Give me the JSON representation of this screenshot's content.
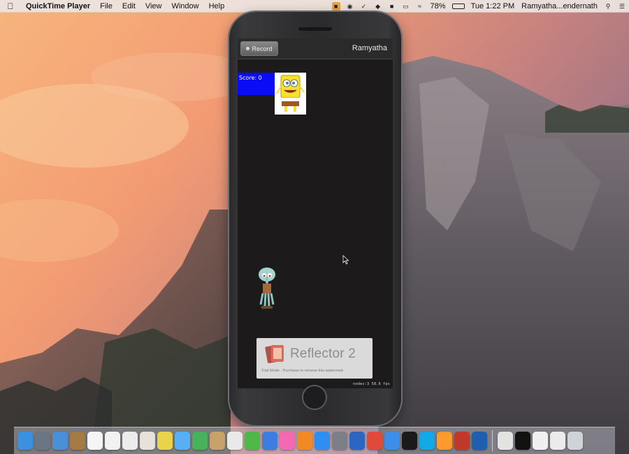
{
  "menubar": {
    "apple_icon": "apple-icon",
    "app_name": "QuickTime Player",
    "menus": [
      "File",
      "Edit",
      "View",
      "Window",
      "Help"
    ],
    "status_icons": [
      "app-status-icon",
      "record-status-icon",
      "check-status-icon",
      "dropbox-icon",
      "notification-icon",
      "airplay-icon",
      "wifi-icon"
    ],
    "battery": "78%",
    "battery_icon": "battery-icon",
    "clock": "Tue 1:22 PM",
    "user": "Ramyatha...endernath",
    "search_icon": "spotlight-search-icon",
    "list_icon": "notification-center-icon"
  },
  "phone": {
    "record_label": "Record",
    "user_label": "Ramyatha",
    "score_text": "Score: 0",
    "watermark_title": "Reflector 2",
    "watermark_sub": "Trial Mode · Purchase to remove this watermark",
    "fps_text": "nodes:3   58.6 fps"
  },
  "dock": {
    "icons": [
      {
        "name": "finder-icon",
        "color": "#3d8fe0"
      },
      {
        "name": "launchpad-icon",
        "color": "#6b7684"
      },
      {
        "name": "preview-icon",
        "color": "#4a8fd8"
      },
      {
        "name": "notes-book-icon",
        "color": "#a57b43"
      },
      {
        "name": "calendar-icon",
        "color": "#f5f5f5"
      },
      {
        "name": "textedit-icon",
        "color": "#f2f2f2"
      },
      {
        "name": "pages-icon",
        "color": "#ececec"
      },
      {
        "name": "photos-icon",
        "color": "#e6e1d9"
      },
      {
        "name": "chrome-legacy-icon",
        "color": "#e8d34a"
      },
      {
        "name": "messages-icon",
        "color": "#58b0f4"
      },
      {
        "name": "facetime-icon",
        "color": "#46b35b"
      },
      {
        "name": "contacts-icon",
        "color": "#c7a36b"
      },
      {
        "name": "stickies-icon",
        "color": "#e9e9e9"
      },
      {
        "name": "numbers-icon",
        "color": "#4fb848"
      },
      {
        "name": "keynote-icon",
        "color": "#3d7de0"
      },
      {
        "name": "itunes-icon",
        "color": "#f36ab3"
      },
      {
        "name": "ibooks-icon",
        "color": "#f08a24"
      },
      {
        "name": "app-store-icon",
        "color": "#2f8ef0"
      },
      {
        "name": "system-preferences-icon",
        "color": "#7c7f85"
      },
      {
        "name": "word-icon",
        "color": "#2b66c4"
      },
      {
        "name": "chrome-icon",
        "color": "#e04a3b"
      },
      {
        "name": "xcode-icon",
        "color": "#3d8ee8"
      },
      {
        "name": "terminal-icon",
        "color": "#1a1a1a"
      },
      {
        "name": "skype-icon",
        "color": "#12a9e6"
      },
      {
        "name": "sublime-icon",
        "color": "#ff9a2e"
      },
      {
        "name": "reflector-icon",
        "color": "#c0392b"
      },
      {
        "name": "quicktime-icon",
        "color": "#1f5fb2"
      },
      {
        "name": "downloads-icon",
        "color": "#e3e3e3"
      },
      {
        "name": "terminal-window-icon",
        "color": "#111111"
      },
      {
        "name": "document-stack-icon",
        "color": "#f0f0f0"
      },
      {
        "name": "document-stack-2-icon",
        "color": "#ebebeb"
      },
      {
        "name": "trash-icon",
        "color": "#cfd3d8"
      }
    ]
  }
}
